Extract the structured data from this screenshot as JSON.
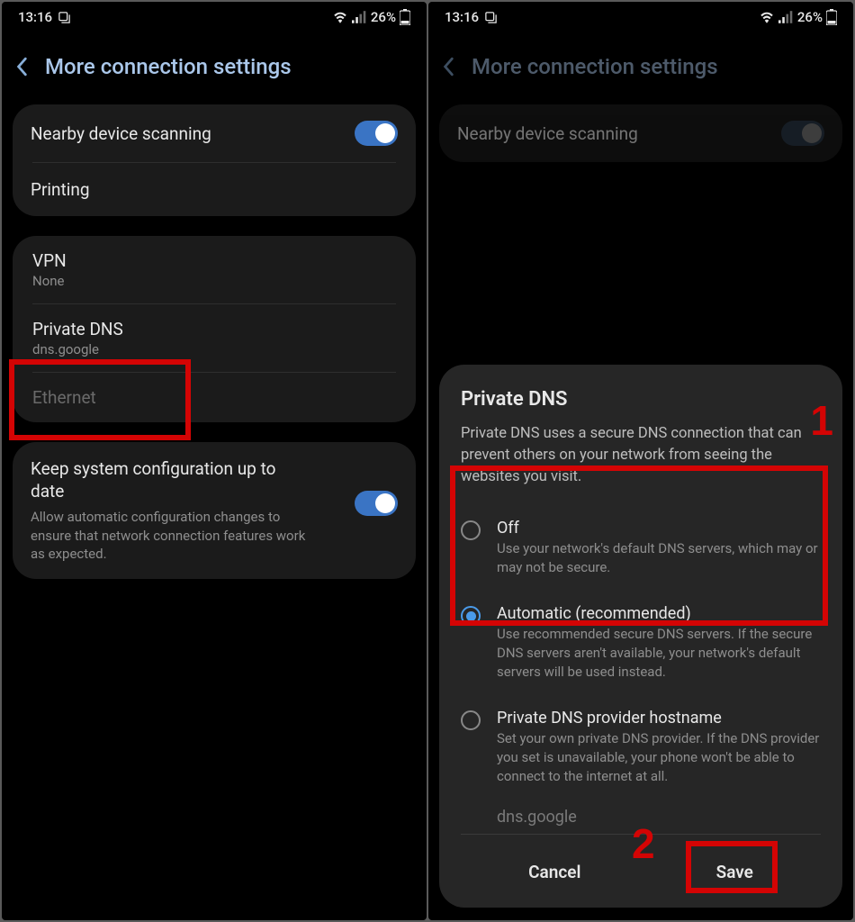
{
  "status": {
    "time": "13:16",
    "battery_pct": "26%"
  },
  "left": {
    "title": "More connection settings",
    "nearby": "Nearby device scanning",
    "printing": "Printing",
    "vpn": {
      "title": "VPN",
      "sub": "None"
    },
    "private_dns": {
      "title": "Private DNS",
      "sub": "dns.google"
    },
    "ethernet": "Ethernet",
    "keep": {
      "title": "Keep system configuration up to date",
      "desc": "Allow automatic configuration changes to ensure that network connection features work as expected."
    }
  },
  "right": {
    "title": "More connection settings",
    "nearby": "Nearby device scanning",
    "dialog": {
      "title": "Private DNS",
      "desc": "Private DNS uses a secure DNS connection that can prevent others on your network from seeing the websites you visit.",
      "off": {
        "title": "Off",
        "desc": "Use your network's default DNS servers, which may or may not be secure."
      },
      "auto": {
        "title": "Automatic (recommended)",
        "desc": "Use recommended secure DNS servers. If the secure DNS servers aren't available, your network's default servers will be used instead."
      },
      "host": {
        "title": "Private DNS provider hostname",
        "desc": "Set your own private DNS provider. If the DNS provider you set is unavailable, your phone won't be able to connect to the internet at all."
      },
      "input_value": "dns.google",
      "cancel": "Cancel",
      "save": "Save"
    }
  },
  "annotations": {
    "one": "1",
    "two": "2"
  }
}
